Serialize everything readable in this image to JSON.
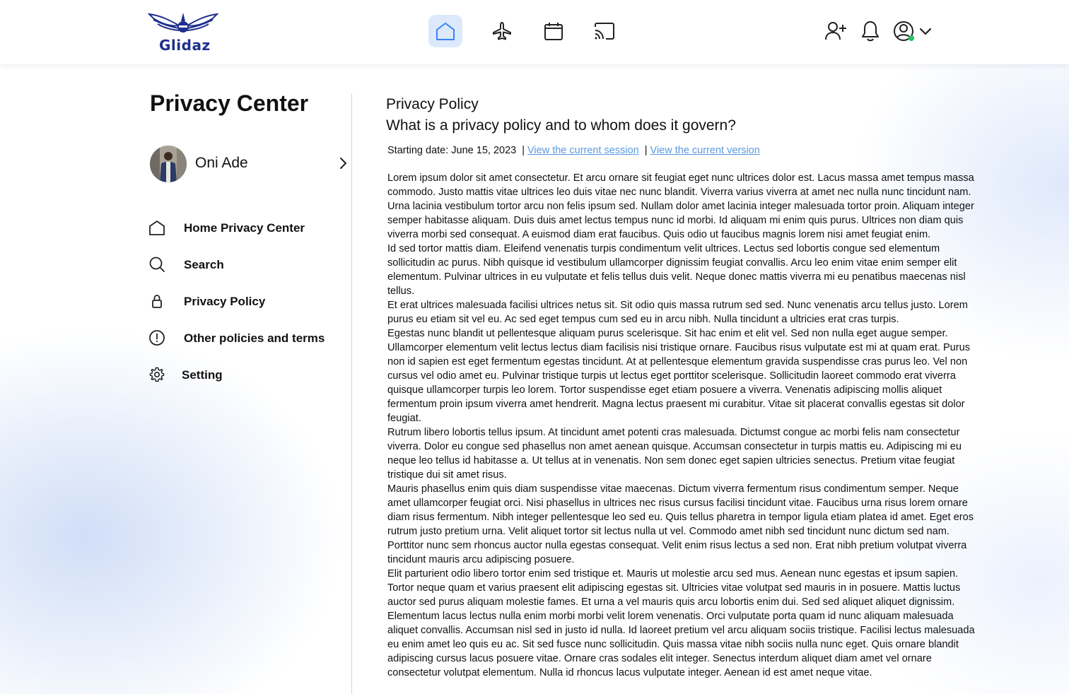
{
  "header": {
    "logo_text": "Glidaz",
    "nav": [
      {
        "name": "home",
        "icon": "home-icon",
        "active": true
      },
      {
        "name": "flights",
        "icon": "airplane-icon",
        "active": false
      },
      {
        "name": "calendar",
        "icon": "calendar-icon",
        "active": false
      },
      {
        "name": "cast",
        "icon": "cast-icon",
        "active": false
      }
    ],
    "actions": [
      "add-user-icon",
      "bell-icon",
      "user-circle-icon",
      "chevron-down-icon"
    ],
    "status_color": "#22c55e",
    "accent": "#dce9fb",
    "brand_color": "#1f2f8c"
  },
  "sidebar": {
    "title": "Privacy Center",
    "profile_name": "Oni Ade",
    "items": [
      {
        "label": "Home Privacy Center",
        "icon": "home-icon"
      },
      {
        "label": "Search",
        "icon": "search-icon"
      },
      {
        "label": "Privacy Policy",
        "icon": "lock-icon"
      },
      {
        "label": "Other policies and terms",
        "icon": "info-icon"
      },
      {
        "label": "Setting",
        "icon": "gear-icon"
      }
    ]
  },
  "main": {
    "title": "Privacy Policy",
    "subtitle": "What is a privacy policy and to whom does it govern?",
    "starting_date": "Starting date: June 15, 2023",
    "separator": "|",
    "link_session": "View the current session",
    "link_version": "View the current version",
    "link_color": "#5b9be0",
    "paragraphs": [
      "Lorem ipsum dolor sit amet consectetur. Et arcu ornare sit feugiat eget nunc ultrices dolor est. Lacus massa amet tempus massa commodo. Justo mattis vitae ultrices leo duis vitae nec nunc blandit. Viverra varius viverra at amet nec nulla nunc tincidunt nam. Urna lacinia vestibulum tortor arcu non felis ipsum sed. Nullam dolor amet lacinia integer malesuada tortor proin. Aliquam integer semper habitasse aliquam. Duis duis amet lectus tempus nunc id morbi. Id aliquam mi enim quis purus. Ultrices non diam quis viverra morbi sed consequat. A euismod diam erat faucibus. Quis odio ut faucibus magnis lorem nisi amet feugiat enim.",
      "Id sed tortor mattis diam. Eleifend venenatis turpis condimentum velit ultrices. Lectus sed lobortis congue sed elementum sollicitudin ac purus. Nibh quisque id vestibulum ullamcorper dignissim feugiat convallis. Arcu leo enim vitae enim semper elit elementum. Pulvinar ultrices in eu vulputate et felis tellus duis velit. Neque donec mattis viverra mi eu penatibus maecenas nisl tellus.",
      "Et erat ultrices malesuada facilisi ultrices netus sit. Sit odio quis massa rutrum sed sed. Nunc venenatis arcu tellus justo. Lorem purus eu etiam sit vel eu. Ac sed eget tempus cum sed eu in arcu nibh. Nulla tincidunt a ultricies erat cras turpis.",
      "Egestas nunc blandit ut pellentesque aliquam purus scelerisque. Sit hac enim et elit vel. Sed non nulla eget augue semper. Ullamcorper elementum velit lectus lectus diam facilisis nisi tristique ornare. Faucibus risus vulputate est mi at quam erat. Purus non id sapien est eget fermentum egestas tincidunt. At at pellentesque elementum gravida suspendisse cras purus leo. Vel non cursus vel odio amet eu. Pulvinar tristique turpis ut lectus eget porttitor scelerisque. Sollicitudin laoreet commodo erat viverra quisque ullamcorper turpis leo lorem. Tortor suspendisse eget etiam posuere a viverra. Venenatis adipiscing mollis aliquet fermentum proin ipsum viverra amet hendrerit. Magna lectus praesent mi curabitur. Vitae sit placerat convallis egestas sit dolor feugiat.",
      "Rutrum libero lobortis tellus ipsum. At tincidunt amet potenti cras malesuada. Dictumst congue ac morbi felis nam consectetur viverra. Dolor eu congue sed phasellus non amet aenean quisque. Accumsan consectetur in turpis mattis eu. Adipiscing mi eu neque leo tellus id habitasse a. Ut tellus at in venenatis. Non sem donec eget sapien ultricies senectus. Pretium vitae feugiat tristique dui sit amet risus.",
      "Mauris phasellus enim quis diam suspendisse vitae maecenas. Dictum viverra fermentum risus condimentum semper. Neque amet ullamcorper feugiat orci. Nisi phasellus in ultrices nec risus cursus facilisi tincidunt vitae. Faucibus urna risus lorem ornare diam risus fermentum. Nibh integer pellentesque leo sed eu. Quis tellus pharetra in tempor ligula etiam platea id amet. Eget eros rutrum justo pretium urna. Velit aliquet tortor sit lectus nulla ut vel. Commodo amet nibh sed tincidunt nunc dictum sed nam. Porttitor nunc sem rhoncus auctor nulla egestas consequat. Velit enim risus lectus a sed non. Erat nibh pretium volutpat viverra tincidunt mauris arcu adipiscing posuere.",
      "Elit parturient odio libero tortor enim sed tristique et. Mauris ut molestie arcu sed mus. Aenean nunc egestas et ipsum sapien. Tortor neque quam et varius praesent elit adipiscing egestas sit. Ultricies vitae volutpat sed mauris in in posuere. Mattis luctus auctor sed purus aliquam molestie fames. Et urna a vel mauris quis arcu lobortis enim dui. Sed sed aliquet aliquet dignissim. Elementum lacus lectus nulla enim morbi morbi velit lorem venenatis. Orci vulputate porta quam id nunc aliquam malesuada aliquet convallis. Accumsan nisl sed in justo id nulla. Id laoreet pretium vel arcu aliquam sociis tristique. Facilisi lectus malesuada eu enim amet leo quis eu ac. Sit sed fusce nunc sollicitudin. Quis massa vitae nibh sociis nulla nunc eget. Quis ornare blandit adipiscing cursus lacus posuere vitae. Ornare cras sodales elit integer. Senectus interdum aliquet diam amet vel ornare consectetur volutpat elementum. Nulla id rhoncus lacus vulputate integer. Aenean id est amet neque vitae."
    ]
  }
}
